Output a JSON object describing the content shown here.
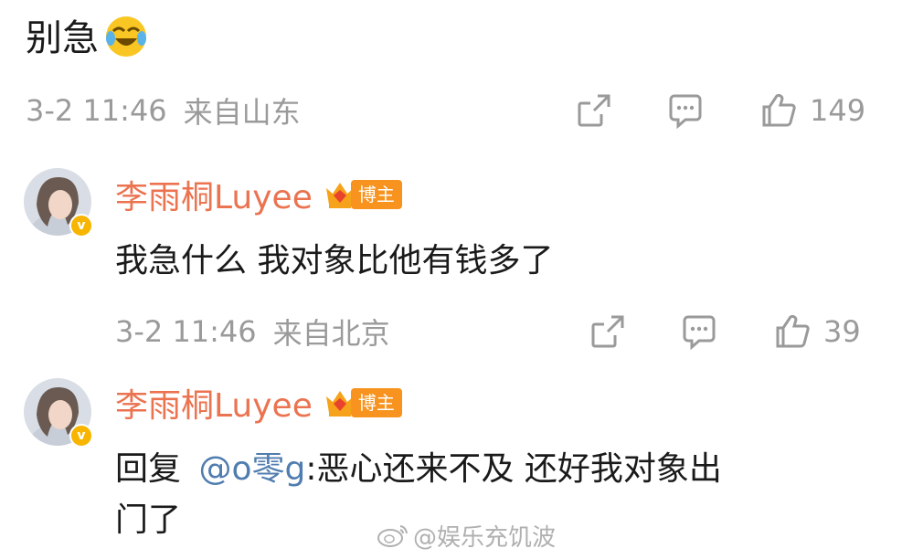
{
  "post": {
    "text": "别急",
    "emoji_icon": "laughing-crying-emoji-icon",
    "timestamp": "3-2 11:46",
    "source": "来自山东",
    "like_count": "149"
  },
  "comments": [
    {
      "username": "李雨桐Luyee",
      "badge_label": "博主",
      "text": "我急什么 我对象比他有钱多了",
      "timestamp": "3-2 11:46",
      "source": "来自北京",
      "like_count": "39"
    },
    {
      "username": "李雨桐Luyee",
      "badge_label": "博主",
      "reply_prefix": "回复",
      "mention": "@o零g",
      "text_line1": ":恶心还来不及 还好我对象出",
      "text_line2": "门了"
    }
  ],
  "watermark": {
    "text": "@娱乐充饥波"
  },
  "colors": {
    "username": "#eb7350",
    "meta_gray": "#9a9a9a",
    "mention_blue": "#507daf",
    "badge_orange": "#f7931e"
  }
}
